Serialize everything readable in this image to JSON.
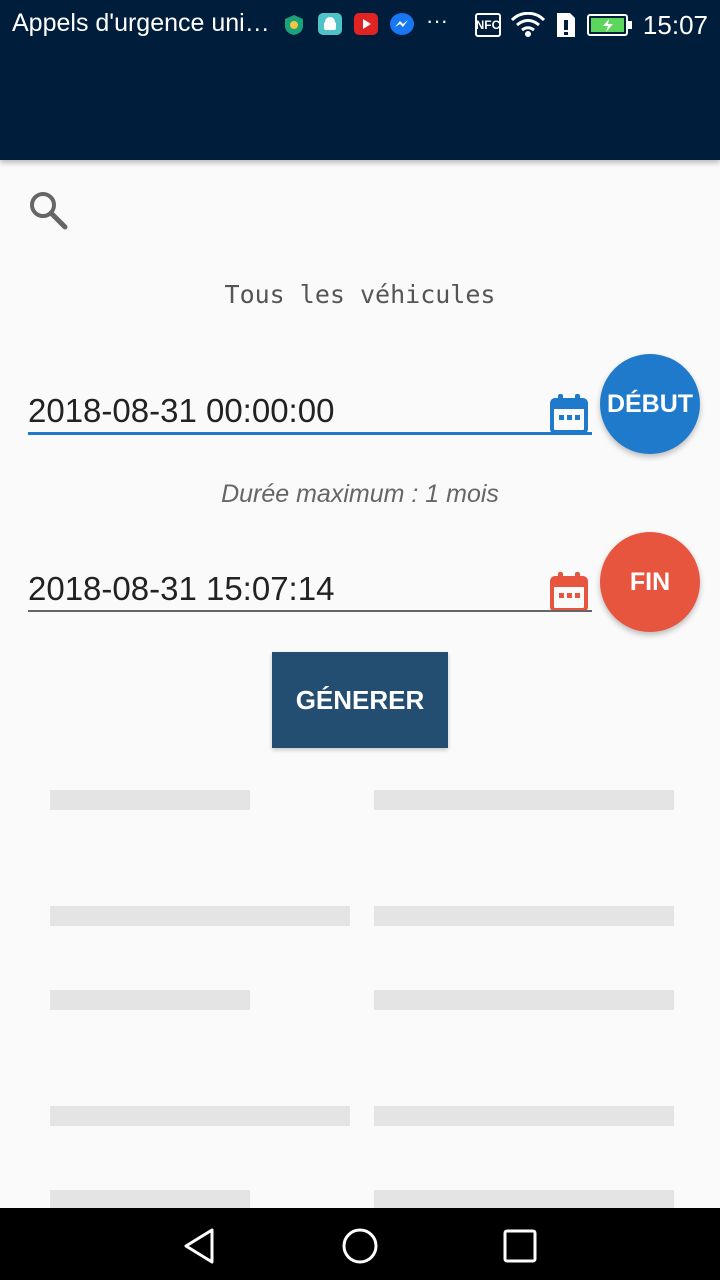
{
  "status_bar": {
    "notification_title": "Appels d'urgence uni…",
    "time": "15:07",
    "icons": [
      "app-shield-icon",
      "android-icon",
      "youtube-icon",
      "messenger-icon",
      "more-icon",
      "nfc-icon",
      "wifi-icon",
      "sim-icon",
      "battery-icon"
    ],
    "nfc_label": "NFC"
  },
  "search": {
    "icon": "search-icon"
  },
  "filter": {
    "vehicle_label": "Tous les véhicules"
  },
  "start": {
    "value": "2018-08-31 00:00:00",
    "button_label": "DÉBUT",
    "color": "#1f7acb"
  },
  "duration_note": "Durée maximum : 1 mois",
  "end": {
    "value": "2018-08-31 15:07:14",
    "button_label": "FIN",
    "color": "#e8553e"
  },
  "generate": {
    "label": "GÉNERER",
    "color": "#244d72"
  },
  "colors": {
    "app_bar": "#001e3c",
    "background": "#fafafa"
  },
  "nav_bar": {
    "icons": [
      "back-icon",
      "home-icon",
      "recents-icon"
    ]
  }
}
